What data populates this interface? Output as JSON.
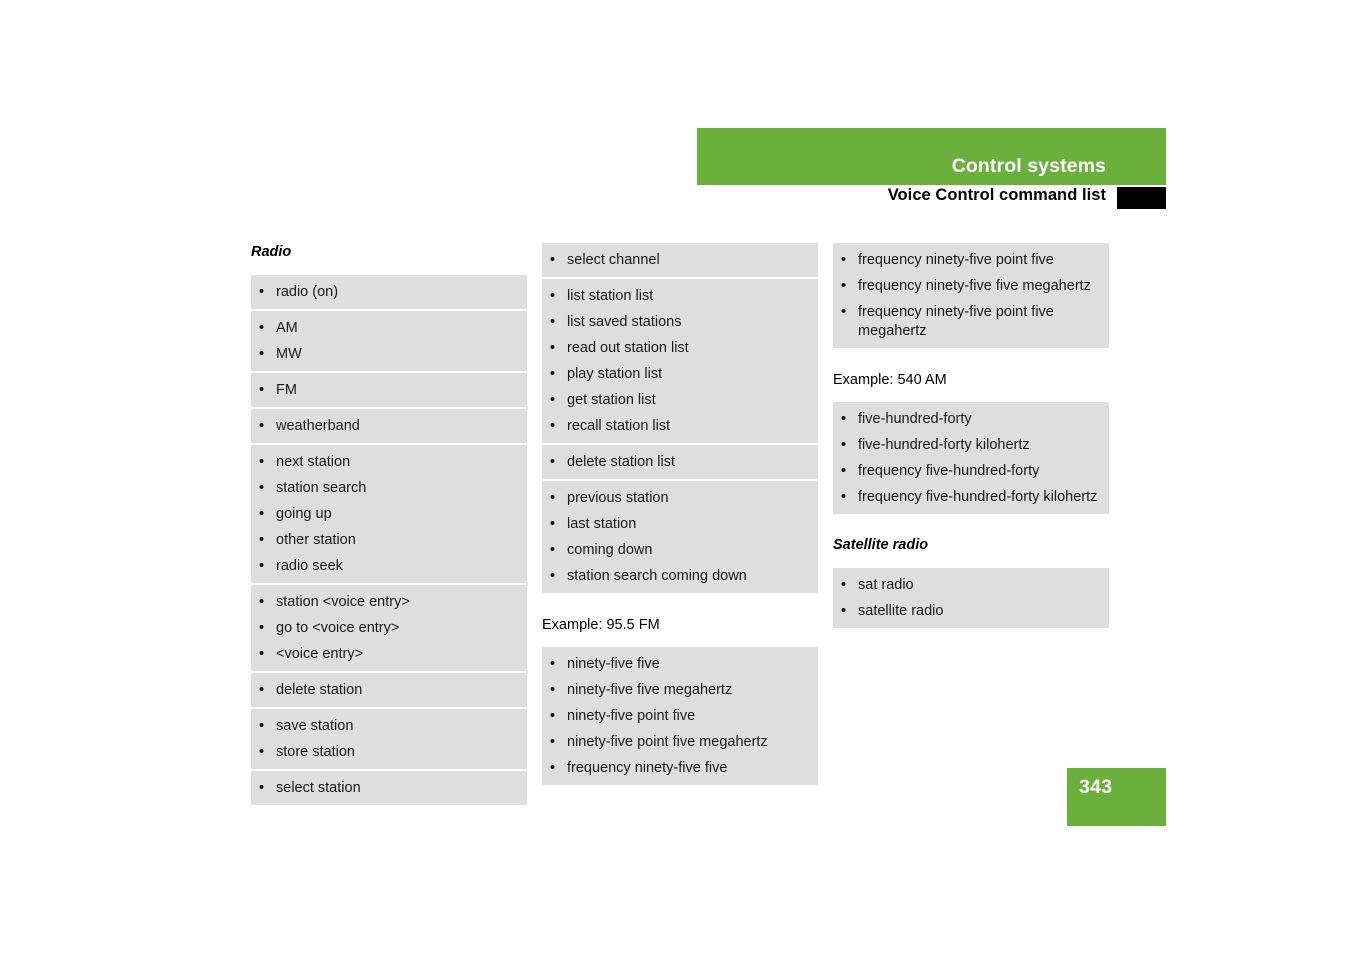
{
  "header": {
    "chapter_title": "Control systems",
    "section_title": "Voice Control command list"
  },
  "footer": {
    "page_number": "343"
  },
  "columns": [
    {
      "id": "column-1",
      "blocks": [
        {
          "kind": "heading",
          "text": "Radio"
        },
        {
          "kind": "list",
          "groups": [
            {
              "items": [
                "radio (on)"
              ]
            },
            {
              "items": [
                "AM",
                "MW"
              ]
            },
            {
              "items": [
                "FM"
              ]
            },
            {
              "items": [
                "weatherband"
              ]
            },
            {
              "items": [
                "next station",
                "station search",
                "going up",
                "other station",
                "radio seek"
              ]
            },
            {
              "items": [
                "station <voice entry>",
                "go to <voice entry>",
                "<voice entry>"
              ]
            },
            {
              "items": [
                "delete station"
              ]
            },
            {
              "items": [
                "save station",
                "store station"
              ]
            },
            {
              "items": [
                "select station"
              ]
            }
          ]
        }
      ]
    },
    {
      "id": "column-2",
      "blocks": [
        {
          "kind": "list",
          "groups": [
            {
              "items": [
                "select channel"
              ]
            },
            {
              "items": [
                "list station list",
                "list saved stations",
                "read out station list",
                "play station list",
                "get station list",
                "recall station list"
              ]
            },
            {
              "items": [
                "delete station list"
              ]
            },
            {
              "items": [
                "previous station",
                "last station",
                "coming down",
                "station search coming down"
              ]
            }
          ]
        },
        {
          "kind": "example",
          "text": "Example: 95.5 FM"
        },
        {
          "kind": "list",
          "groups": [
            {
              "items": [
                "ninety-five five",
                "ninety-five five megahertz",
                "ninety-five point five",
                "ninety-five point five megahertz",
                "frequency ninety-five five"
              ]
            }
          ]
        }
      ]
    },
    {
      "id": "column-3",
      "blocks": [
        {
          "kind": "list",
          "groups": [
            {
              "items": [
                "frequency ninety-five point five",
                "frequency ninety-five five megahertz",
                "frequency ninety-five point five megahertz"
              ]
            }
          ]
        },
        {
          "kind": "example",
          "text": "Example: 540 AM"
        },
        {
          "kind": "list",
          "groups": [
            {
              "items": [
                "five-hundred-forty",
                "five-hundred-forty kilohertz",
                "frequency five-hundred-forty",
                "frequency five-hundred-forty kilohertz"
              ]
            }
          ]
        },
        {
          "kind": "heading",
          "text": "Satellite radio"
        },
        {
          "kind": "list",
          "groups": [
            {
              "items": [
                "sat radio",
                "satellite radio"
              ]
            }
          ]
        }
      ]
    }
  ],
  "colors": {
    "accent_green": "#6bb03c",
    "list_background": "#dedede",
    "tab_marker": "#000000"
  },
  "icons": {
    "bullet": "bullet-icon"
  }
}
